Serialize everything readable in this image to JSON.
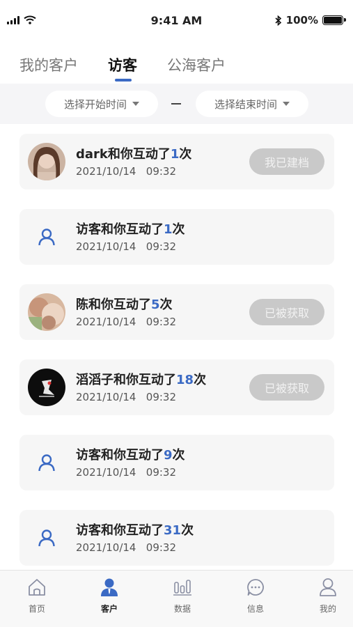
{
  "status_bar": {
    "time": "9:41 AM",
    "battery": "100%"
  },
  "tabs": [
    {
      "label": "我的客户",
      "active": false
    },
    {
      "label": "访客",
      "active": true
    },
    {
      "label": "公海客户",
      "active": false
    }
  ],
  "accent_color": "#3b6ac4",
  "filter": {
    "start_label": "选择开始时间",
    "end_label": "选择结束时间",
    "separator": "—"
  },
  "visitors": [
    {
      "name": "dark",
      "middle": "和你互动了",
      "count": "1",
      "suffix": "次",
      "date": "2021/10/14",
      "time": "09:32",
      "avatar": "photo-woman",
      "action": "我已建档"
    },
    {
      "name": "访客",
      "middle": "和你互动了",
      "count": "1",
      "suffix": "次",
      "date": "2021/10/14",
      "time": "09:32",
      "avatar": "default-user-icon",
      "action": ""
    },
    {
      "name": "陈",
      "middle": "和你互动了",
      "count": "5",
      "suffix": "次",
      "date": "2021/10/14",
      "time": "09:32",
      "avatar": "photo-blurred",
      "action": "已被获取"
    },
    {
      "name": "滔滔子",
      "middle": "和你互动了",
      "count": "18",
      "suffix": "次",
      "date": "2021/10/14",
      "time": "09:32",
      "avatar": "photo-dark-figure",
      "action": "已被获取"
    },
    {
      "name": "访客",
      "middle": "和你互动了",
      "count": "9",
      "suffix": "次",
      "date": "2021/10/14",
      "time": "09:32",
      "avatar": "default-user-icon",
      "action": ""
    },
    {
      "name": "访客",
      "middle": "和你互动了",
      "count": "31",
      "suffix": "次",
      "date": "2021/10/14",
      "time": "09:32",
      "avatar": "default-user-icon",
      "action": ""
    }
  ],
  "bottom_nav": [
    {
      "label": "首页",
      "icon": "home-icon",
      "active": false
    },
    {
      "label": "客户",
      "icon": "customer-icon",
      "active": true
    },
    {
      "label": "数据",
      "icon": "data-chart-icon",
      "active": false
    },
    {
      "label": "信息",
      "icon": "message-icon",
      "active": false
    },
    {
      "label": "我的",
      "icon": "profile-icon",
      "active": false
    }
  ]
}
